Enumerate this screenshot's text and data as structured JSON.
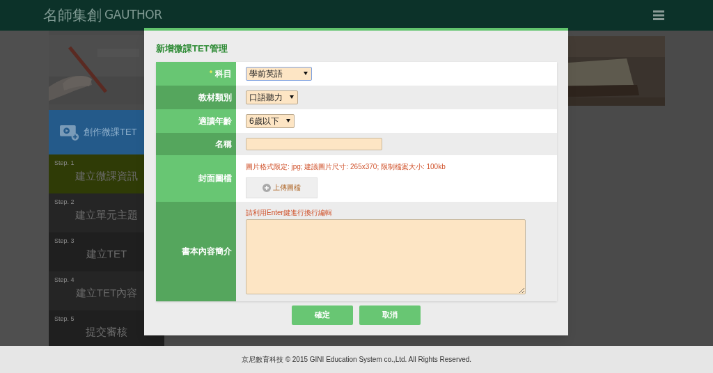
{
  "header": {
    "logo_text": "名師集創",
    "logo_mark": "GAUTHOR"
  },
  "sidebar": {
    "card": {
      "label": "創作微課TET"
    },
    "steps": [
      {
        "step": "Step. 1",
        "label": "建立微課資訊",
        "selected": true
      },
      {
        "step": "Step. 2",
        "label": "建立單元主題",
        "selected": false
      },
      {
        "step": "Step. 3",
        "label": "建立TET",
        "selected": false
      },
      {
        "step": "Step. 4",
        "label": "建立TET內容",
        "selected": false
      },
      {
        "step": "Step. 5",
        "label": "提交審核",
        "selected": false
      }
    ]
  },
  "dialog": {
    "title": "新增微課TET管理",
    "required_symbol": "*",
    "rows": [
      {
        "label": "科目",
        "required": true,
        "kind": "select",
        "value": "學前英語",
        "focused": true
      },
      {
        "label": "教材類別",
        "required": false,
        "kind": "select",
        "value": "口語聽力",
        "focused": false
      },
      {
        "label": "適讀年齡",
        "required": false,
        "kind": "select",
        "value": "6歲以下",
        "focused": false
      },
      {
        "label": "名稱",
        "required": false,
        "kind": "input"
      },
      {
        "label": "封面圖檔",
        "required": false,
        "kind": "upload",
        "hint": "圖片格式限定: jpg; 建議圖片尺寸: 265x370; 限制檔案大小: 100kb",
        "button": "上傳圖檔"
      },
      {
        "label": "書本內容簡介",
        "required": false,
        "kind": "textarea",
        "hint": "請利用Enter鍵進行換行編輯"
      }
    ],
    "buttons": [
      "確定",
      "取消"
    ]
  },
  "footer": {
    "text": "京尼數育科技 © 2015 GINI Education System co.,Ltd. All Rights Reserved."
  }
}
